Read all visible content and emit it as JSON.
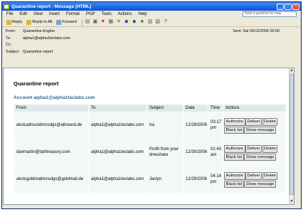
{
  "window": {
    "title": "Quarantine report - Message (HTML)"
  },
  "menu": {
    "items": [
      "File",
      "Edit",
      "View",
      "Insert",
      "Format",
      "PGP",
      "Tools",
      "Actions",
      "Help"
    ],
    "help_placeholder": "Type a question for help"
  },
  "toolbar": {
    "reply": "Reply",
    "reply_all": "Reply to All",
    "forward": "Forward"
  },
  "header": {
    "from_label": "From:",
    "from": "Quarantine Engine",
    "to_label": "To:",
    "to": "alpha1@alpha1teclabs.com",
    "cc_label": "Cc:",
    "cc": "",
    "subject_label": "Subject:",
    "subject": "Quarantine report",
    "sent": "Sent:  Sat 30/12/2006 06:00"
  },
  "report": {
    "title": "Quarantine report",
    "account": "Account alpha1@alpha1teclabs.com",
    "columns": [
      "From",
      "To",
      "Subject",
      "Date",
      "Time",
      "Actions"
    ],
    "action_labels": {
      "authorize": "Authorize",
      "deliver": "Deliver",
      "delete": "Delete",
      "blacklist": "Black list",
      "show": "Show message"
    },
    "rows": [
      {
        "from": "akstcallroundmnsdgs@allround.de",
        "to": "alpha1@alpha1teclabs.com",
        "subject": "Ira",
        "date": "12/29/2006",
        "time": "03:17 pm"
      },
      {
        "from": "danmartin@tarttreasury.com",
        "to": "alpha1@alpha1teclabs.com",
        "subject": "Profit from your timeshare",
        "date": "12/30/2006",
        "time": "01:43 am"
      },
      {
        "from": "akstcgoldmailmnsdgs@goldmail.de",
        "to": "alpha1@alpha1teclabs.com",
        "subject": "Jaclyn",
        "date": "12/29/2006",
        "time": "04:14 pm"
      }
    ]
  }
}
